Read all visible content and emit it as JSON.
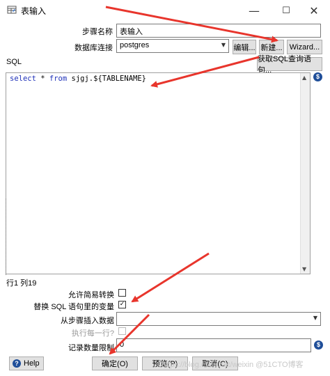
{
  "window": {
    "title": "表输入",
    "minimize": "—",
    "maximize": "☐",
    "close": "✕"
  },
  "form": {
    "step_name_label": "步骤名称",
    "step_name_value": "表输入",
    "db_connection_label": "数据库连接",
    "db_connection_value": "postgres",
    "edit_button": "编辑...",
    "new_button": "新建...",
    "wizard_button": "Wizard...",
    "sql_label": "SQL",
    "get_sql_button": "获取SQL查询语句...",
    "sql_keyword_1": "select",
    "sql_star": " * ",
    "sql_keyword_2": "from",
    "sql_rest": " sjgj.${TABLENAME}",
    "position_status": "行1 列19",
    "lazy_conversion_label": "允许简易转换",
    "lazy_conversion_checked": false,
    "replace_vars_label": "替换 SQL 语句里的变量",
    "replace_vars_checked": true,
    "replace_vars_mark": "✓",
    "insert_from_step_label": "从步骤插入数据",
    "insert_from_step_value": "",
    "execute_each_row_label": "执行每一行?",
    "execute_each_row_checked": false,
    "limit_label": "记录数量限制",
    "limit_value": "0",
    "dollar_icon": "$",
    "diamond_icon": "◆"
  },
  "footer": {
    "help_button": "Help",
    "ok_button": "确定(O)",
    "preview_button": "预览(P)",
    "cancel_button": "取消(C)",
    "watermark": "https://blog.csdn.net/weixin @51CTO博客"
  },
  "colors": {
    "annotation_arrow": "#e8352c",
    "sql_keyword": "#1d2fb8"
  }
}
